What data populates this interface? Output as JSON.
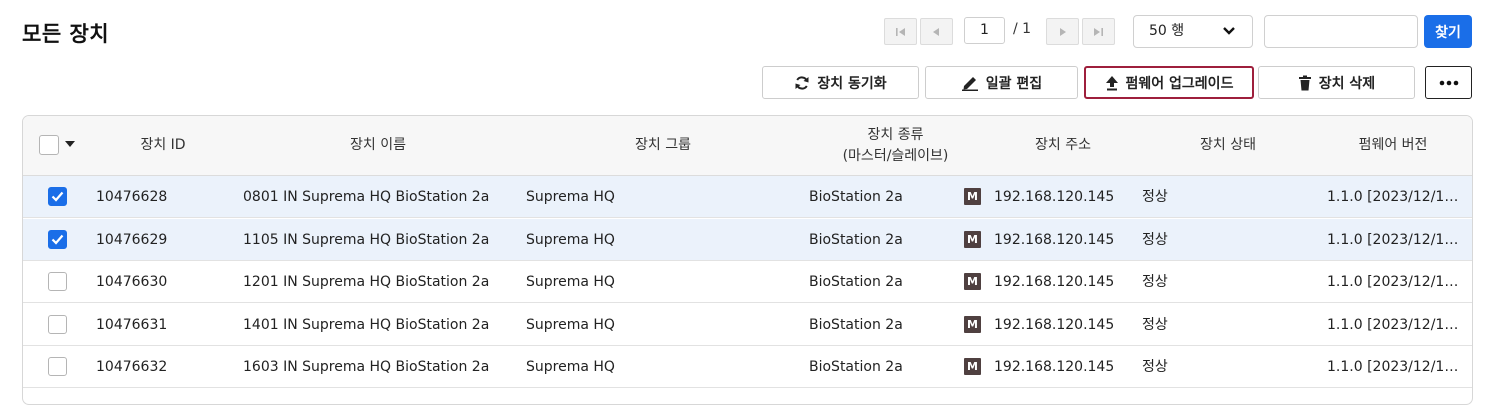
{
  "page": {
    "title": "모든 장치"
  },
  "pagination": {
    "current_page": "1",
    "total": "/ 1"
  },
  "rows_per_page": {
    "selected": "50 행"
  },
  "search": {
    "value": "",
    "button_label": "찾기"
  },
  "toolbar": {
    "sync_label": "장치 동기화",
    "batch_edit_label": "일괄 편집",
    "firmware_upgrade_label": "펌웨어 업그레이드",
    "delete_label": "장치 삭제",
    "more_label": "•••"
  },
  "table": {
    "headers": {
      "device_id": "장치 ID",
      "device_name": "장치 이름",
      "device_group": "장치 그룹",
      "device_type_line1": "장치 종류",
      "device_type_line2": "(마스터/슬레이브)",
      "address": "장치 주소",
      "status": "장치 상태",
      "firmware": "펌웨어 버전"
    },
    "rows": [
      {
        "selected": true,
        "id": "10476628",
        "name": "0801 IN Suprema HQ BioStation 2a",
        "group": "Suprema HQ",
        "type": "BioStation 2a",
        "role_badge": "M",
        "address": "192.168.120.145",
        "status": "정상",
        "firmware": "1.1.0 [2023/12/1…"
      },
      {
        "selected": true,
        "id": "10476629",
        "name": "1105 IN Suprema HQ BioStation 2a",
        "group": "Suprema HQ",
        "type": "BioStation 2a",
        "role_badge": "M",
        "address": "192.168.120.145",
        "status": "정상",
        "firmware": "1.1.0 [2023/12/1…"
      },
      {
        "selected": false,
        "id": "10476630",
        "name": "1201 IN Suprema HQ BioStation 2a",
        "group": "Suprema HQ",
        "type": "BioStation 2a",
        "role_badge": "M",
        "address": "192.168.120.145",
        "status": "정상",
        "firmware": "1.1.0 [2023/12/1…"
      },
      {
        "selected": false,
        "id": "10476631",
        "name": "1401 IN Suprema HQ BioStation 2a",
        "group": "Suprema HQ",
        "type": "BioStation 2a",
        "role_badge": "M",
        "address": "192.168.120.145",
        "status": "정상",
        "firmware": "1.1.0 [2023/12/1…"
      },
      {
        "selected": false,
        "id": "10476632",
        "name": "1603 IN Suprema HQ BioStation 2a",
        "group": "Suprema HQ",
        "type": "BioStation 2a",
        "role_badge": "M",
        "address": "192.168.120.145",
        "status": "정상",
        "firmware": "1.1.0 [2023/12/1…"
      }
    ]
  },
  "colors": {
    "accent": "#1a6ee8",
    "highlight_border": "#9e1f3c",
    "selected_row": "#ebf2fb",
    "badge": "#4f4040"
  }
}
